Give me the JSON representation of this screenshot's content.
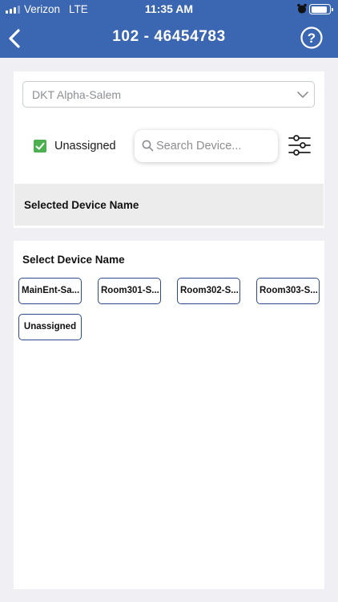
{
  "status_bar": {
    "carrier": "Verizon",
    "network": "LTE",
    "time": "11:35 AM"
  },
  "nav": {
    "title": "102 - 46454783",
    "back_icon": "chevron-left-icon",
    "help_icon": "question-circle-icon"
  },
  "location_select": {
    "selected": "DKT Alpha-Salem"
  },
  "unassigned_filter": {
    "label": "Unassigned",
    "checked": true
  },
  "search": {
    "placeholder": "Search Device..."
  },
  "selected_section": {
    "title": "Selected Device Name"
  },
  "select_section": {
    "title": "Select Device Name",
    "devices": [
      "MainEnt-Sa...",
      "Room301-S...",
      "Room302-S...",
      "Room303-S...",
      "Unassigned"
    ]
  },
  "colors": {
    "header": "#3b66b1",
    "checkbox": "#4caf50",
    "chip_border": "#2c4a8c"
  }
}
